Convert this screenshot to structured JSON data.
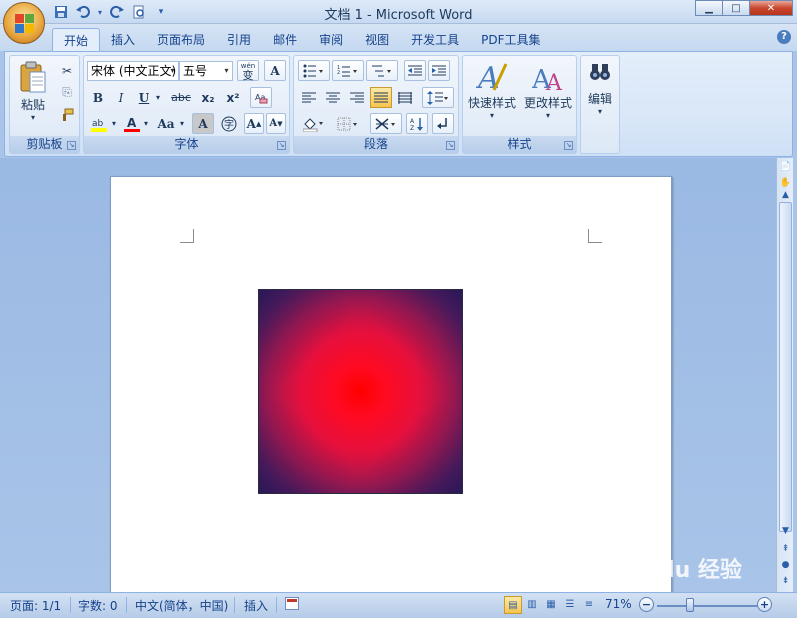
{
  "window": {
    "title": "文档 1 - Microsoft Word"
  },
  "qat": [
    {
      "name": "save-icon",
      "glyph": "💾"
    },
    {
      "name": "undo-icon",
      "glyph": "↶"
    },
    {
      "name": "redo-icon",
      "glyph": "↻"
    },
    {
      "name": "print-preview-icon",
      "glyph": "🔍"
    },
    {
      "name": "customize-qat-icon",
      "glyph": "▾"
    }
  ],
  "tabs": [
    "开始",
    "插入",
    "页面布局",
    "引用",
    "邮件",
    "审阅",
    "视图",
    "开发工具",
    "PDF工具集"
  ],
  "ribbon": {
    "clipboard": {
      "label": "剪贴板",
      "paste": "粘贴"
    },
    "font": {
      "label": "字体",
      "font_name": "宋体 (中文正文)",
      "font_size": "五号",
      "wen": "wén",
      "bold": "B",
      "italic": "I",
      "underline": "U",
      "strike": "abc",
      "subscript": "x₂",
      "superscript": "x²",
      "case": "Aa",
      "grow": "A",
      "shrink": "A"
    },
    "paragraph": {
      "label": "段落"
    },
    "styles": {
      "label": "样式",
      "quick_styles": "快速样式",
      "change_styles": "更改样式"
    },
    "editing": {
      "label": "编辑",
      "edit": "编辑"
    }
  },
  "status": {
    "page": "页面: 1/1",
    "words": "字数: 0",
    "language": "中文(简体，中国)",
    "mode": "插入",
    "zoom": "71%"
  },
  "watermark": "Bai du 经验"
}
